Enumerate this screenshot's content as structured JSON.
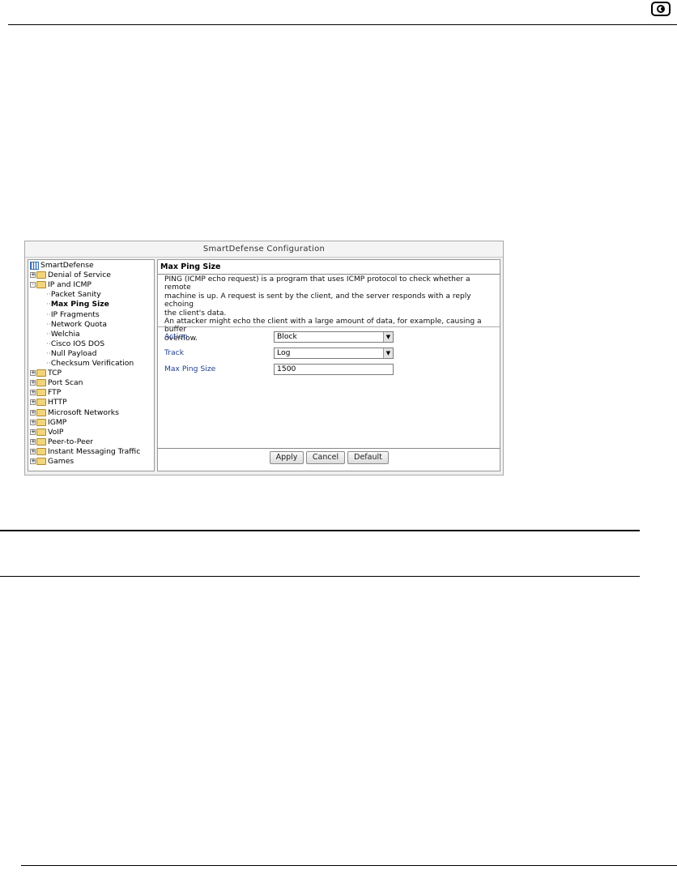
{
  "window": {
    "title": "SmartDefense Configuration"
  },
  "tree": {
    "root": "SmartDefense",
    "items": [
      {
        "label": "Denial of Service",
        "exp": "+"
      },
      {
        "label": "IP and ICMP",
        "exp": "-"
      },
      {
        "label": "Packet Sanity"
      },
      {
        "label": "Max Ping Size",
        "selected": true
      },
      {
        "label": "IP Fragments"
      },
      {
        "label": "Network Quota"
      },
      {
        "label": "Welchia"
      },
      {
        "label": "Cisco IOS DOS"
      },
      {
        "label": "Null Payload"
      },
      {
        "label": "Checksum Verification"
      },
      {
        "label": "TCP",
        "exp": "+"
      },
      {
        "label": "Port Scan",
        "exp": "+"
      },
      {
        "label": "FTP",
        "exp": "+"
      },
      {
        "label": "HTTP",
        "exp": "+"
      },
      {
        "label": "Microsoft Networks",
        "exp": "+"
      },
      {
        "label": "IGMP",
        "exp": "+"
      },
      {
        "label": "VoIP",
        "exp": "+"
      },
      {
        "label": "Peer-to-Peer",
        "exp": "+"
      },
      {
        "label": "Instant Messaging Traffic",
        "exp": "+"
      },
      {
        "label": "Games",
        "exp": "+"
      }
    ]
  },
  "panel": {
    "title": "Max Ping Size",
    "description": [
      "PING (ICMP echo request) is a program that uses ICMP protocol to check whether a remote",
      "machine is up. A request is sent by the client, and the server responds with a reply echoing",
      "the client's data.",
      "An attacker might echo the client with a large amount of data, for example, causing a buffer",
      "overflow."
    ],
    "fields": {
      "action_label": "Action",
      "action_value": "Block",
      "track_label": "Track",
      "track_value": "Log",
      "size_label": "Max Ping Size",
      "size_value": "1500"
    },
    "buttons": {
      "apply": "Apply",
      "cancel": "Cancel",
      "default": "Default"
    }
  },
  "icons": {
    "logo": "check-point-logo-icon",
    "dropdown": "chevron-down-icon",
    "folder": "folder-icon"
  }
}
